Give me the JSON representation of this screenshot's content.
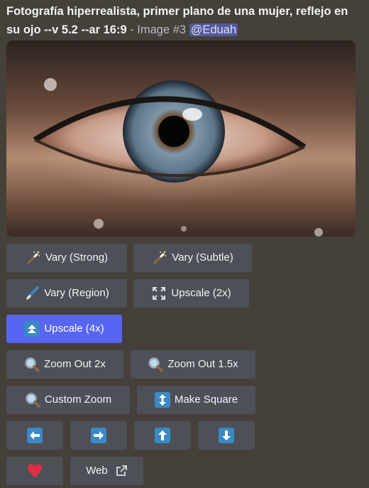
{
  "message": {
    "prompt": "Fotografía hiperrealista, primer plano de una mujer, reflejo en su ojo --v 5.2 --ar 16:9",
    "suffix": " - Image #3 ",
    "mention": "@Eduah"
  },
  "buttons": {
    "vary_strong": "Vary (Strong)",
    "vary_subtle": "Vary (Subtle)",
    "vary_region": "Vary (Region)",
    "upscale_2x": "Upscale (2x)",
    "upscale_4x": "Upscale (4x)",
    "zoom_out_2x": "Zoom Out 2x",
    "zoom_out_15x": "Zoom Out 1.5x",
    "custom_zoom": "Custom Zoom",
    "make_square": "Make Square",
    "web": "Web"
  },
  "colors": {
    "background": "#45403a",
    "button": "#4e5058",
    "primary_button": "#5865f2",
    "mention_bg": "#525a99"
  },
  "icons": {
    "vary_strong": "magic-wand-icon",
    "vary_subtle": "magic-wand-icon",
    "vary_region": "paintbrush-icon",
    "upscale_2x": "expand-icon",
    "upscale_4x": "double-up-arrow-icon",
    "zoom": "magnifying-glass-icon",
    "make_square": "up-down-arrow-icon",
    "pan": [
      "left-arrow-icon",
      "right-arrow-icon",
      "up-arrow-icon",
      "down-arrow-icon"
    ],
    "favorite": "heart-icon",
    "web": "external-link-icon"
  }
}
